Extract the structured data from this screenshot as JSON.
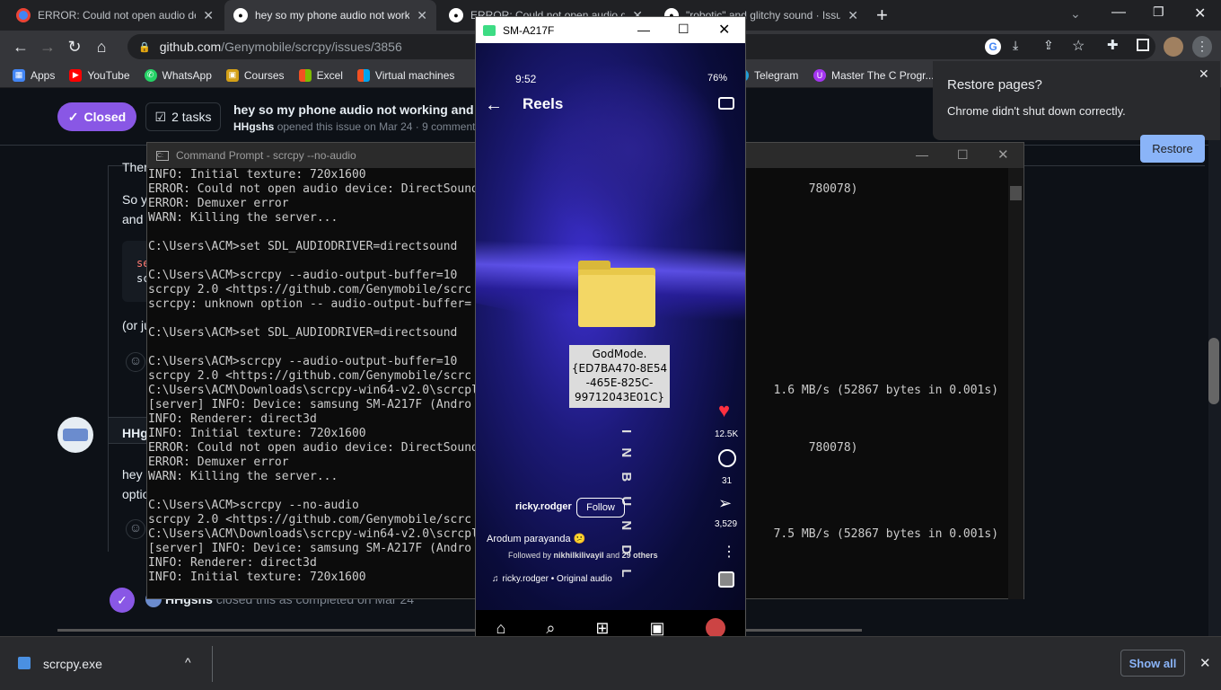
{
  "tabs": [
    {
      "title": "ERROR: Could not open audio de",
      "icon": "chrome-red-icon"
    },
    {
      "title": "hey so my phone audio not work",
      "icon": "github-icon"
    },
    {
      "title": "ERROR: Could not open audio de",
      "icon": "github-icon"
    },
    {
      "title": "\"robotic\" and glitchy sound · Issu",
      "icon": "github-icon"
    }
  ],
  "url": {
    "host": "github.com",
    "path": "/Genymobile/scrcpy/issues/3856"
  },
  "bookmarks": [
    "Apps",
    "YouTube",
    "WhatsApp",
    "Courses",
    "Excel",
    "Virtual machines",
    "Telegram",
    "Master The C Progr..."
  ],
  "restore": {
    "title": "Restore pages?",
    "message": "Chrome didn't shut down correctly.",
    "button": "Restore"
  },
  "issue": {
    "status": "Closed",
    "tasks": "2 tasks",
    "title": "hey so my phone audio not working and it",
    "author": "HHgshs",
    "meta": "opened this issue on Mar 24 · 9 comments",
    "partial": [
      "Ther",
      "So y",
      "and",
      "se",
      "sc",
      "(or ju",
      "HHg",
      "hey",
      "optio"
    ],
    "closed_text": "closed this as completed on Mar 24"
  },
  "cmd": {
    "title": "Command Prompt - scrcpy  --no-audio",
    "lines": [
      "INFO: Initial texture: 720x1600",
      "ERROR: Could not open audio device: DirectSound                                               780078)",
      "ERROR: Demuxer error",
      "WARN: Killing the server...",
      "",
      "C:\\Users\\ACM>set SDL_AUDIODRIVER=directsound",
      "",
      "C:\\Users\\ACM>scrcpy --audio-output-buffer=10",
      "scrcpy 2.0 <https://github.com/Genymobile/scrc",
      "scrcpy: unknown option -- audio-output-buffer=",
      "",
      "C:\\Users\\ACM>set SDL_AUDIODRIVER=directsound",
      "",
      "C:\\Users\\ACM>scrcpy --audio-output-buffer=10",
      "scrcpy 2.0 <https://github.com/Genymobile/scrc",
      "C:\\Users\\ACM\\Downloads\\scrcpy-win64-v2.0\\scrcpl                                          1.6 MB/s (52867 bytes in 0.001s)",
      "[server] INFO: Device: samsung SM-A217F (Andro",
      "INFO: Renderer: direct3d",
      "INFO: Initial texture: 720x1600",
      "ERROR: Could not open audio device: DirectSound                                               780078)",
      "ERROR: Demuxer error",
      "WARN: Killing the server...",
      "",
      "C:\\Users\\ACM>scrcpy --no-audio",
      "scrcpy 2.0 <https://github.com/Genymobile/scrc",
      "C:\\Users\\ACM\\Downloads\\scrcpy-win64-v2.0\\scrcpl                                          7.5 MB/s (52867 bytes in 0.001s)",
      "[server] INFO: Device: samsung SM-A217F (Andro",
      "INFO: Renderer: direct3d",
      "INFO: Initial texture: 720x1600"
    ]
  },
  "phone": {
    "window_title": "SM-A217F",
    "time": "9:52",
    "battery": "76%",
    "screen_title": "Reels",
    "folder_label": "GodMode.\n{ED7BA470-8E54\n-465E-825C-\n99712043E01C}",
    "likes": "12.5K",
    "comments": "31",
    "shares": "3,529",
    "username": "ricky.rodger",
    "follow": "Follow",
    "caption": "Arodum parayanda 😕",
    "followed_by": "Followed by",
    "followed_name": "nikhilkilivayil",
    "followed_and": "and",
    "followed_others": "29 others",
    "audio": "ricky.rodger • Original audio",
    "vertical_text": "I N   B U N D L"
  },
  "downloads": {
    "file": "scrcpy.exe",
    "show_all": "Show all"
  }
}
